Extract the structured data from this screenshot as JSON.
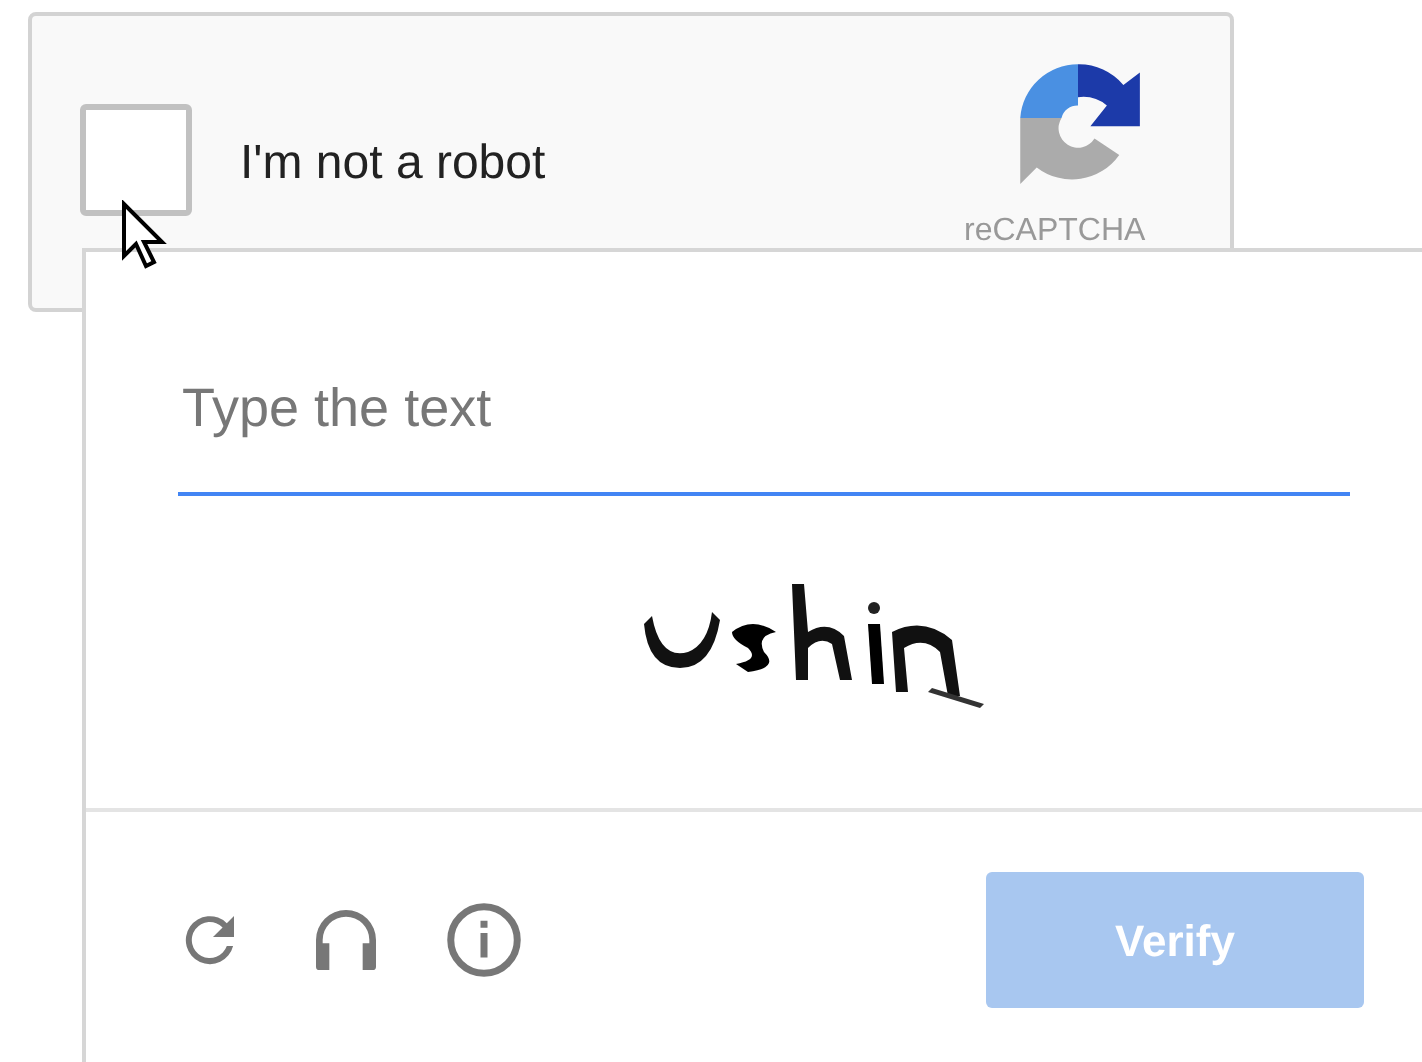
{
  "recaptcha": {
    "checkbox": {
      "label": "I'm not a robot",
      "checked": false
    },
    "brand": "reCAPTCHA"
  },
  "challenge": {
    "input": {
      "placeholder": "Type the text"
    },
    "verify_button": {
      "label": "Verify",
      "disabled": true
    }
  }
}
